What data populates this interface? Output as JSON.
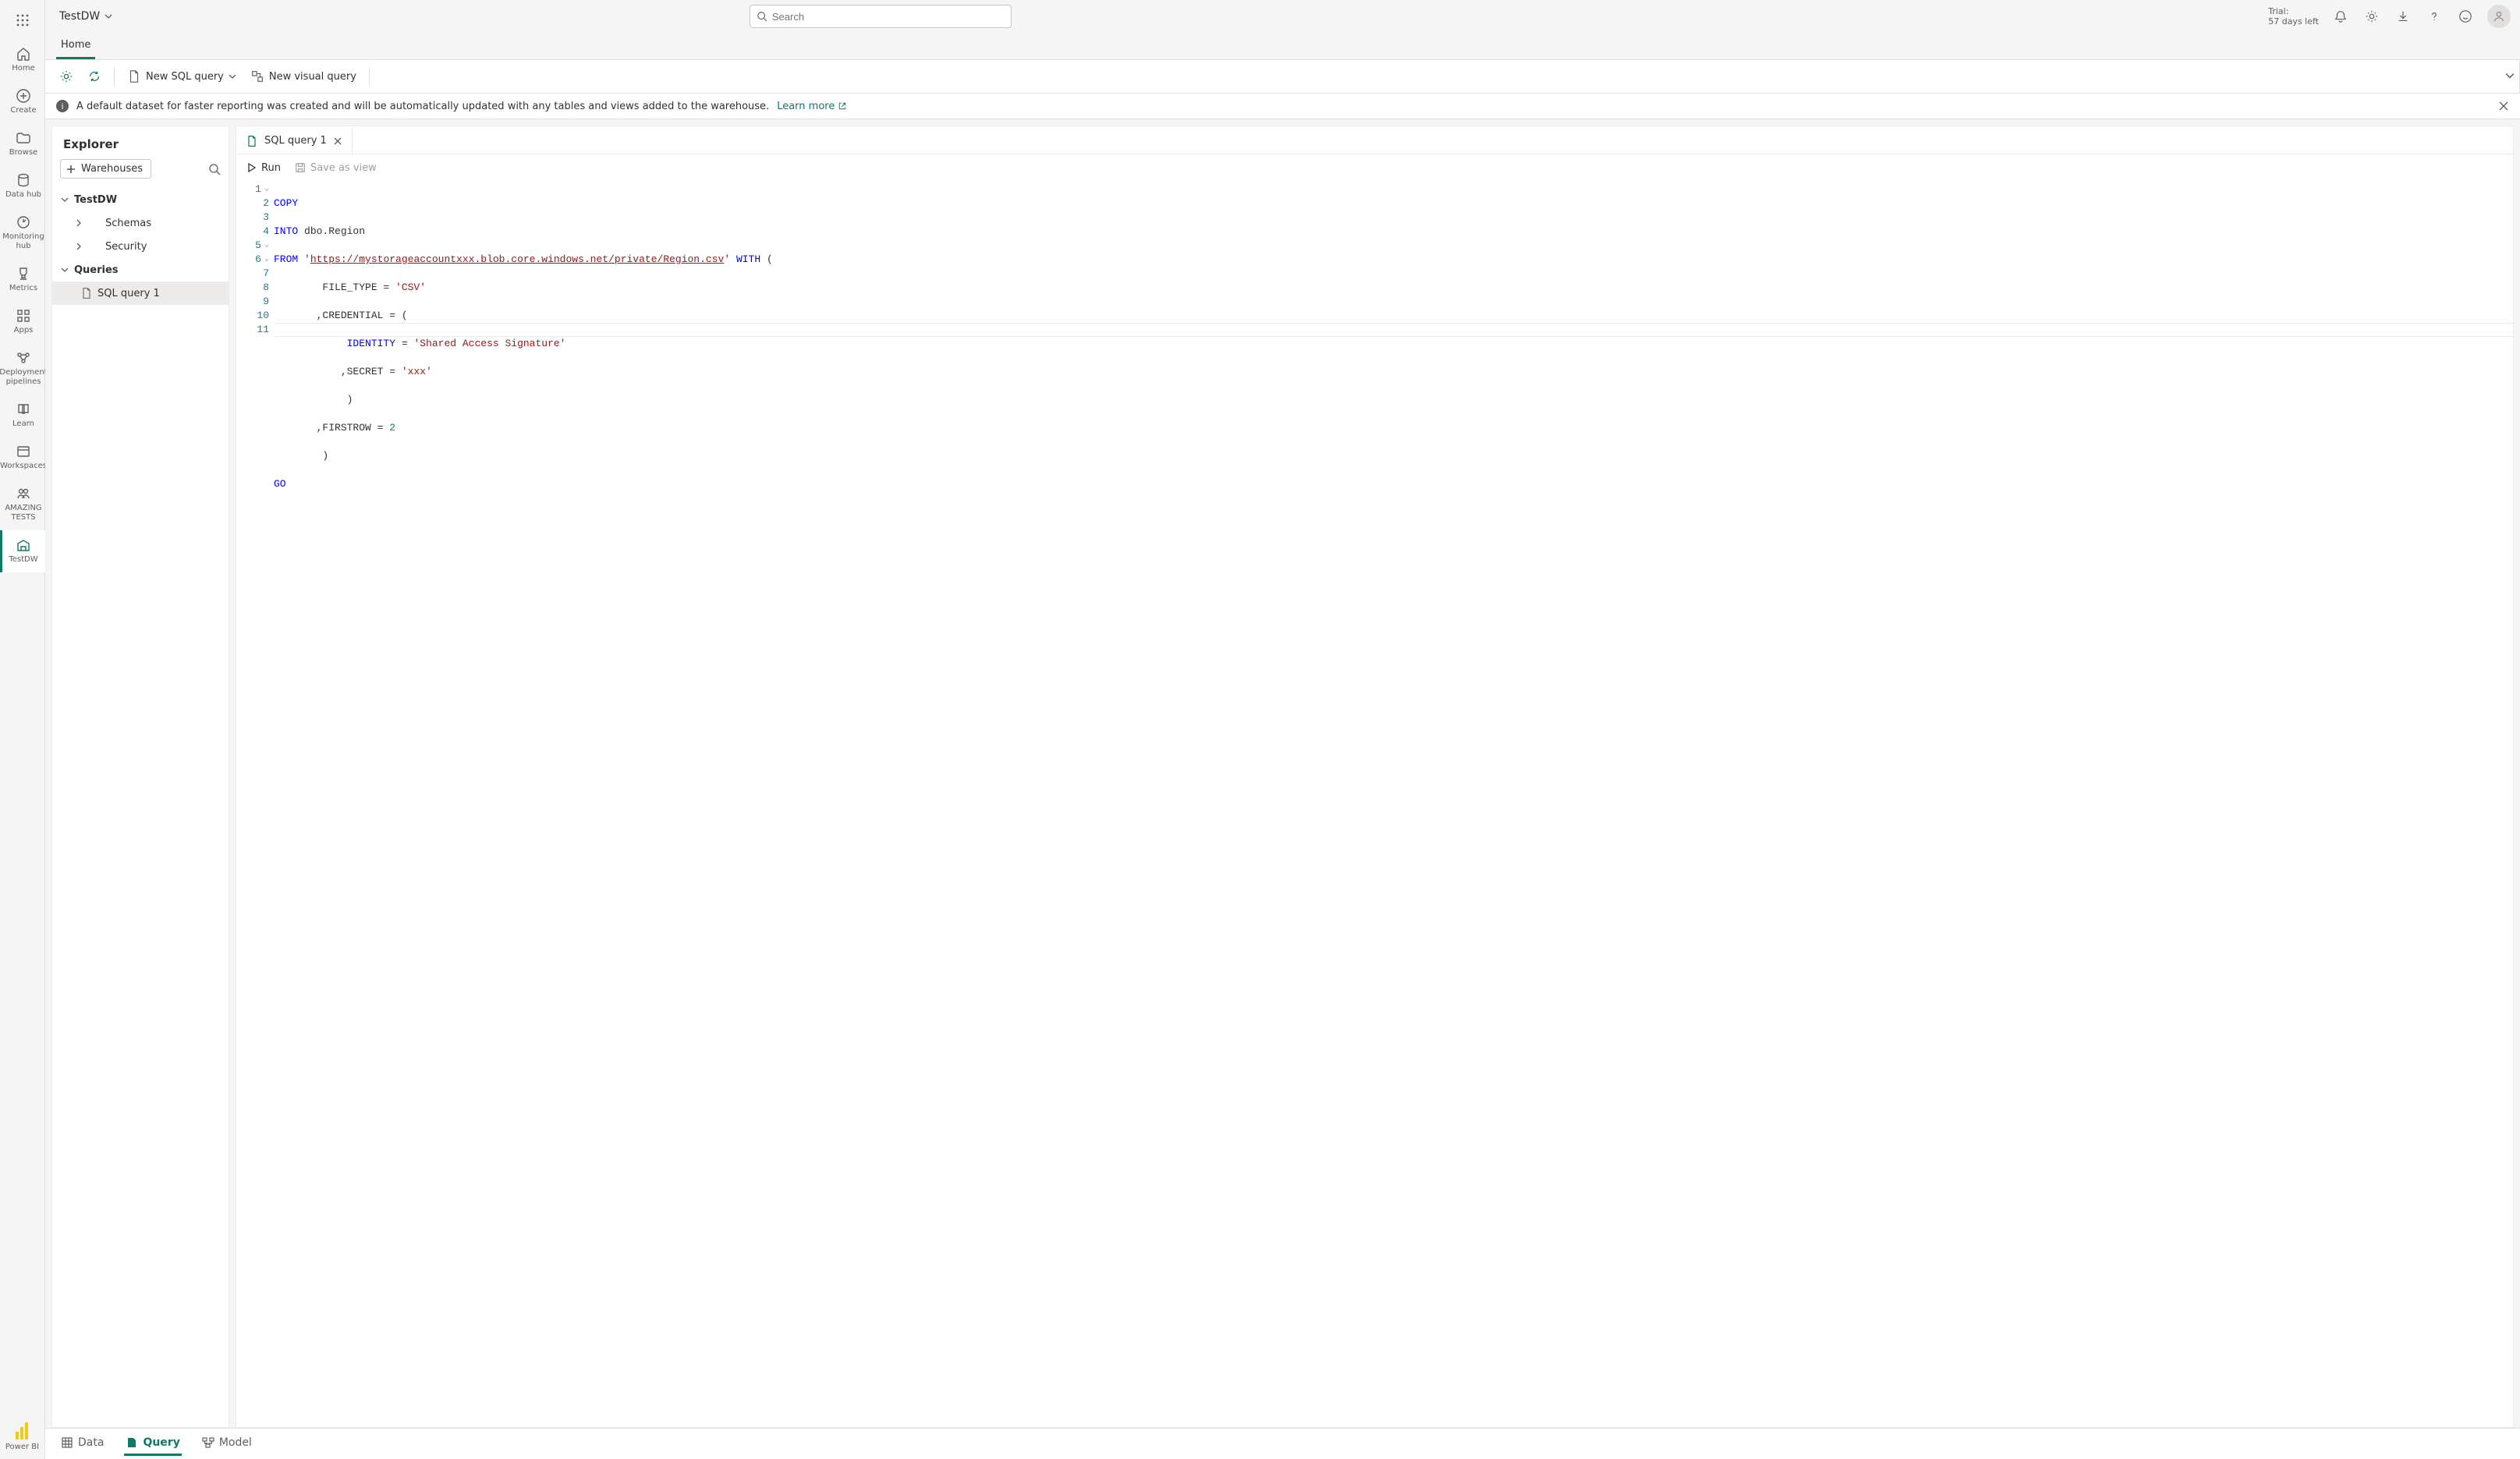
{
  "workspace_name": "TestDW",
  "search": {
    "placeholder": "Search"
  },
  "trial": {
    "line1": "Trial:",
    "line2": "57 days left"
  },
  "global_nav": {
    "items": [
      {
        "label": "Home"
      },
      {
        "label": "Create"
      },
      {
        "label": "Browse"
      },
      {
        "label": "Data hub"
      },
      {
        "label": "Monitoring hub"
      },
      {
        "label": "Metrics"
      },
      {
        "label": "Apps"
      },
      {
        "label": "Deployment pipelines"
      },
      {
        "label": "Learn"
      },
      {
        "label": "Workspaces"
      },
      {
        "label": "AMAZING TESTS"
      },
      {
        "label": "TestDW"
      }
    ],
    "footer_label": "Power BI"
  },
  "nav_tab": "Home",
  "toolbar": {
    "new_sql_query": "New SQL query",
    "new_visual_query": "New visual query"
  },
  "banner": {
    "text": "A default dataset for faster reporting was created and will be automatically updated with any tables and views added to the warehouse.",
    "learn_more": "Learn more"
  },
  "explorer": {
    "title": "Explorer",
    "add_button": "Warehouses",
    "tree": {
      "warehouse": "TestDW",
      "schemas": "Schemas",
      "security": "Security",
      "queries": "Queries",
      "query1": "SQL query 1"
    }
  },
  "tab": {
    "title": "SQL query 1"
  },
  "runbar": {
    "run": "Run",
    "save_as_view": "Save as view"
  },
  "code": {
    "lines": [
      "1",
      "2",
      "3",
      "4",
      "5",
      "6",
      "7",
      "8",
      "9",
      "10",
      "11"
    ],
    "l1_kw": "COPY",
    "l2_kw": "INTO",
    "l2_rest": " dbo.Region",
    "l3_kw": "FROM",
    "l3_q1": " '",
    "l3_url": "https://mystorageaccountxxx.blob.core.windows.net/private/Region.csv",
    "l3_q2": "'",
    "l3_with": " WITH",
    "l3_paren": " (",
    "l4_pre": "        FILE_TYPE = ",
    "l4_str": "'CSV'",
    "l5_pre": "       ,CREDENTIAL = (",
    "l6_pre": "            ",
    "l6_kw": "IDENTITY",
    "l6_eq": " = ",
    "l6_str": "'Shared Access Signature'",
    "l7_pre": "           ,SECRET = ",
    "l7_str": "'xxx'",
    "l8_pre": "            )",
    "l9_pre": "       ,FIRSTROW = ",
    "l9_num": "2",
    "l10_pre": "        )",
    "l11_kw": "GO"
  },
  "bottom_tabs": {
    "data": "Data",
    "query": "Query",
    "model": "Model"
  }
}
